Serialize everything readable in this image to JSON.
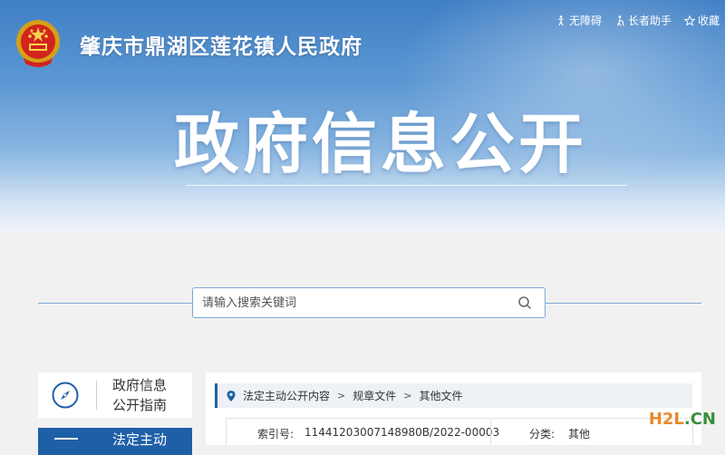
{
  "header": {
    "site_title": "肇庆市鼎湖区莲花镇人民政府",
    "links": [
      {
        "label": "无障碍",
        "icon": "accessibility-icon"
      },
      {
        "label": "长者助手",
        "icon": "elder-helper-icon"
      },
      {
        "label": "收藏",
        "icon": "star-icon"
      }
    ]
  },
  "hero": {
    "title": "政府信息公开"
  },
  "search": {
    "placeholder": "请输入搜索关键词"
  },
  "sidebar": {
    "guide": {
      "line1": "政府信息",
      "line2": "公开指南"
    },
    "active": {
      "label": "法定主动"
    }
  },
  "breadcrumb": [
    "法定主动公开内容",
    "规章文件",
    "其他文件"
  ],
  "info": {
    "index_label": "索引号:",
    "index_value": "11441203007148980B/2022-00003",
    "category_label": "分类:",
    "category_value": "其他"
  },
  "watermark": {
    "part1": "H2L",
    "part2": ".CN"
  },
  "colors": {
    "accent": "#1f5fa8",
    "hero_top": "#3f7fc5",
    "watermark_orange": "#e7892a",
    "watermark_green": "#3a8f3a"
  }
}
